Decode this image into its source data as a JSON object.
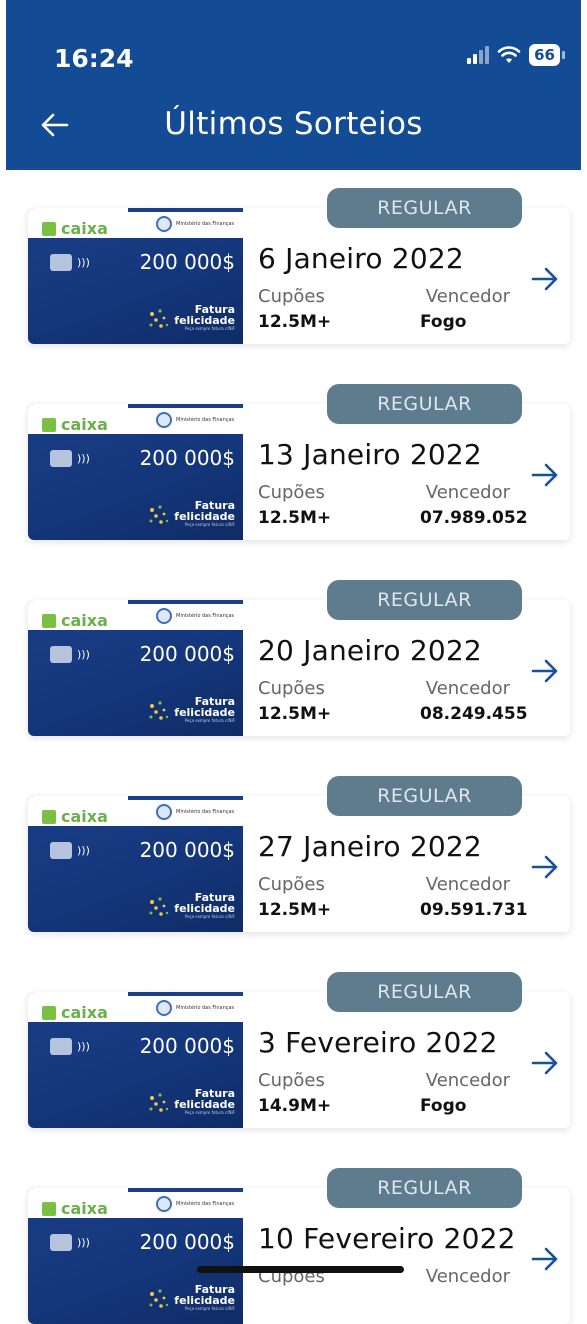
{
  "status_bar": {
    "time": "16:24",
    "battery": "66"
  },
  "header": {
    "title": "Últimos Sorteios"
  },
  "card_thumb": {
    "brand": "caixa",
    "ministry": "Ministério das Finanças",
    "amount": "200 000$",
    "fatura_line1": "Fatura",
    "fatura_line2": "felicidade",
    "fatura_sub": "Peça sempre fatura c/NIF"
  },
  "labels": {
    "cupoes": "Cupões",
    "vencedor": "Vencedor"
  },
  "draws": [
    {
      "badge": "REGULAR",
      "date": "6 Janeiro 2022",
      "coupons": "12.5M+",
      "winner": "Fogo"
    },
    {
      "badge": "REGULAR",
      "date": "13 Janeiro 2022",
      "coupons": "12.5M+",
      "winner": "07.989.052"
    },
    {
      "badge": "REGULAR",
      "date": "20 Janeiro 2022",
      "coupons": "12.5M+",
      "winner": "08.249.455"
    },
    {
      "badge": "REGULAR",
      "date": "27 Janeiro 2022",
      "coupons": "12.5M+",
      "winner": "09.591.731"
    },
    {
      "badge": "REGULAR",
      "date": "3 Fevereiro 2022",
      "coupons": "14.9M+",
      "winner": "Fogo"
    },
    {
      "badge": "REGULAR",
      "date": "10 Fevereiro 2022",
      "coupons": "",
      "winner": ""
    }
  ]
}
